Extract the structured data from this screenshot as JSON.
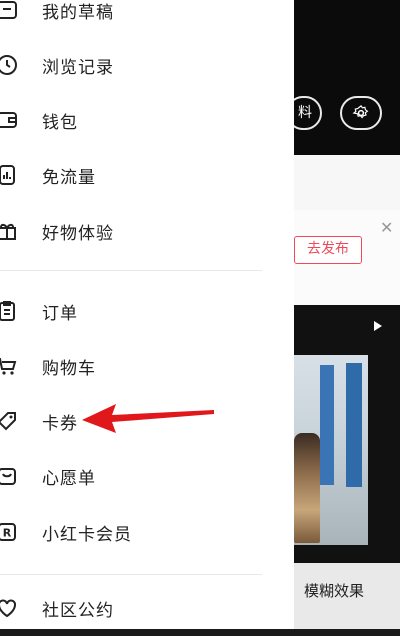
{
  "menu": {
    "items": [
      {
        "label": "我的草稿",
        "icon": "drafts-icon"
      },
      {
        "label": "浏览记录",
        "icon": "history-icon"
      },
      {
        "label": "钱包",
        "icon": "wallet-icon"
      },
      {
        "label": "免流量",
        "icon": "data-free-icon"
      },
      {
        "label": "好物体验",
        "icon": "gift-icon"
      },
      {
        "label": "订单",
        "icon": "order-icon"
      },
      {
        "label": "购物车",
        "icon": "cart-icon"
      },
      {
        "label": "卡券",
        "icon": "coupon-icon"
      },
      {
        "label": "心愿单",
        "icon": "wishlist-icon"
      },
      {
        "label": "小红卡会员",
        "icon": "membership-icon"
      },
      {
        "label": "社区公约",
        "icon": "community-icon"
      }
    ]
  },
  "background": {
    "pill_text": "料",
    "publish_button": "去发布",
    "bottom_text": "模糊效果"
  },
  "colors": {
    "accent_red": "#f04a5a",
    "arrow_red": "#e0181c"
  }
}
